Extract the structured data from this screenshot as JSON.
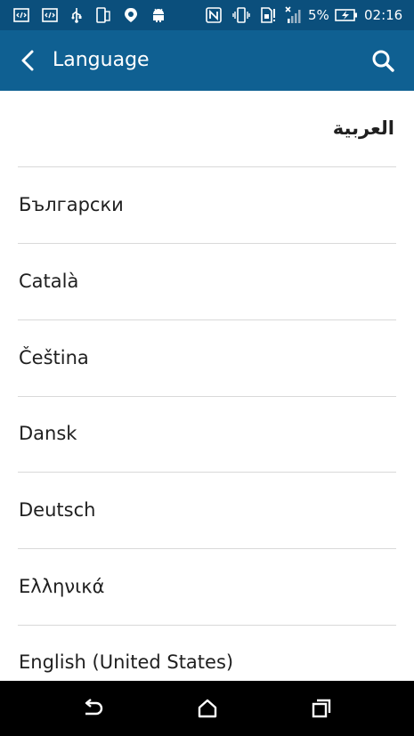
{
  "status_bar": {
    "battery_percent": "5%",
    "time": "02:16",
    "icons": [
      "code-icon",
      "code-icon",
      "usb-icon",
      "phone-icon",
      "location-icon",
      "android-icon",
      "nfc-icon",
      "vibrate-icon",
      "sim-alert-icon",
      "signal-icon",
      "battery-charging-icon"
    ]
  },
  "app_bar": {
    "title": "Language",
    "back_icon": "chevron-left-icon",
    "search_icon": "search-icon"
  },
  "languages": [
    {
      "label": "العربية",
      "rtl": true
    },
    {
      "label": "Български"
    },
    {
      "label": "Català"
    },
    {
      "label": "Čeština"
    },
    {
      "label": "Dansk"
    },
    {
      "label": "Deutsch"
    },
    {
      "label": "Ελληνικά"
    },
    {
      "label": "English (United States)"
    }
  ],
  "nav_bar": {
    "icons": [
      "back-nav-icon",
      "home-icon",
      "recents-icon"
    ]
  },
  "colors": {
    "status_bar": "#0b4f7c",
    "app_bar": "#0f6092",
    "list_text": "#1f1f1f",
    "divider": "#d9d9d9",
    "nav_bar": "#000000"
  }
}
